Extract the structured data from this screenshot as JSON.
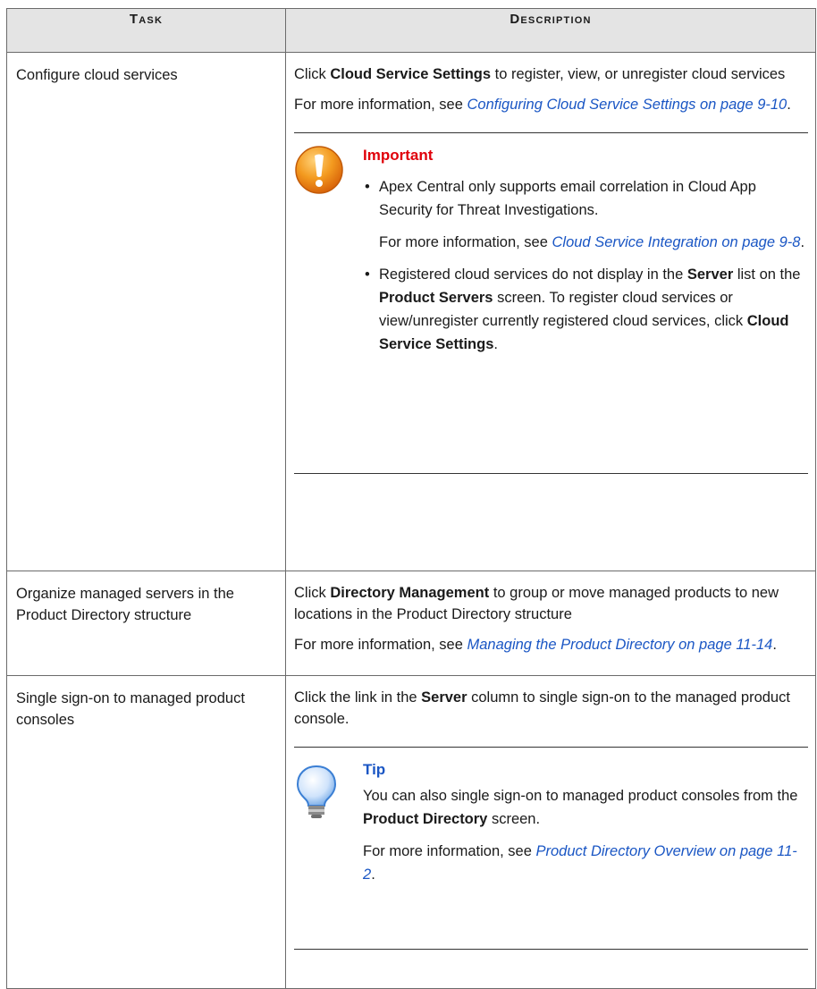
{
  "header": {
    "task": "Task",
    "description": "Description"
  },
  "rows": [
    {
      "task": "Configure cloud services",
      "desc_pre": "Click ",
      "desc_bold": "Cloud Service Settings",
      "desc_post": " to register, view, or unregister cloud services",
      "more_pre": "For more information, see ",
      "more_link": "Configuring Cloud Service Settings on page 9-10",
      "more_post": ".",
      "note": {
        "title": "Important",
        "icon": "exclamation-icon",
        "bullet1_text": "Apex Central only supports email correlation in Cloud App Security for Threat Investigations.",
        "bullet1_more_pre": "For more information, see ",
        "bullet1_more_link": "Cloud Service Integration on page 9-8",
        "bullet1_more_post": ".",
        "bullet2_a": "Registered cloud services do not display in the ",
        "bullet2_b": "Server",
        "bullet2_c": " list on the ",
        "bullet2_d": "Product Servers",
        "bullet2_e": " screen. To register cloud services or view/unregister currently registered cloud services, click ",
        "bullet2_f": "Cloud Service Settings",
        "bullet2_g": "."
      }
    },
    {
      "task": "Organize managed servers in the Product Directory structure",
      "desc_pre": "Click ",
      "desc_bold": "Directory Management",
      "desc_post": " to group or move managed products to new locations in the Product Directory structure",
      "more_pre": "For more information, see ",
      "more_link": "Managing the Product Directory on page 11-14",
      "more_post": "."
    },
    {
      "task": "Single sign-on to managed product consoles",
      "desc_pre": "Click the link in the ",
      "desc_bold": "Server",
      "desc_post": " column to single sign-on to the managed product console.",
      "note": {
        "title": "Tip",
        "icon": "lightbulb-icon",
        "text_a": "You can also single sign-on to managed product consoles from the ",
        "text_b": "Product Directory",
        "text_c": " screen.",
        "more_pre": "For more information, see ",
        "more_link": "Product Directory Overview on page 11-2",
        "more_post": "."
      }
    }
  ]
}
